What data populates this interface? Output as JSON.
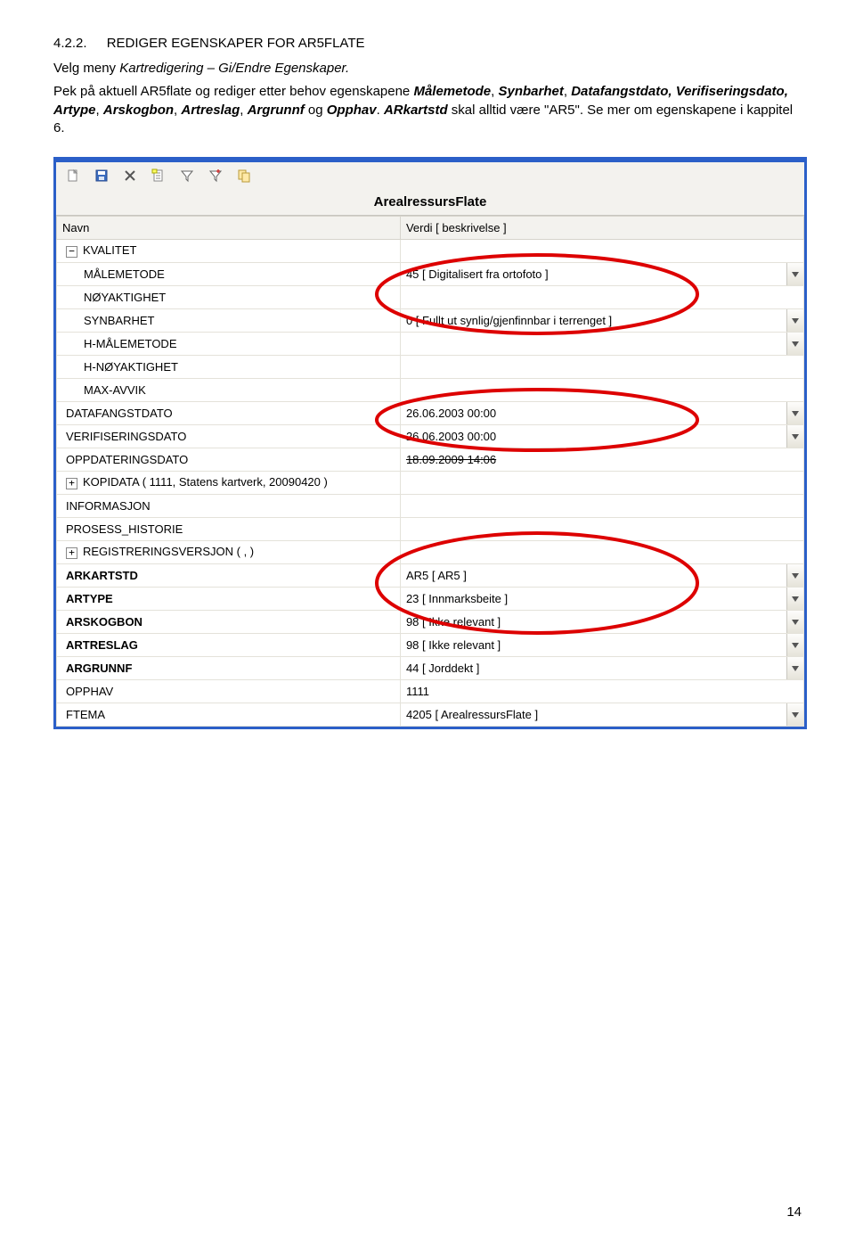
{
  "heading": {
    "num": "4.2.2.",
    "title": "REDIGER EGENSKAPER FOR AR5FLATE"
  },
  "p1_a": "Velg meny ",
  "p1_b": "Kartredigering – Gi/Endre Egenskaper.",
  "p2_a": "Pek på aktuell AR5flate og rediger etter behov egenskapene ",
  "p2_b": "Målemetode",
  "p2_c": ", ",
  "p2_d": "Synbarhet",
  "p2_e": ", ",
  "p2_f": "Datafangstdato, Verifiseringsdato, Artype",
  "p2_g": ", ",
  "p2_h": "Arskogbon",
  "p2_i": ", ",
  "p2_j": "Artreslag",
  "p2_k": ", ",
  "p2_l": "Argrunnf",
  "p2_m": " og ",
  "p2_n": "Opphav",
  "p2_o": ". ",
  "p2_p": "ARkartstd",
  "p2_q": " skal alltid være \"AR5\". Se mer om egenskapene i kappitel 6.",
  "panelTitle": "ArealressursFlate",
  "cols": {
    "name": "Navn",
    "value": "Verdi [ beskrivelse ]"
  },
  "rows": [
    {
      "label": "KVALITET",
      "value": "",
      "level": 0,
      "bold": false,
      "exp": "-"
    },
    {
      "label": "MÅLEMETODE",
      "value": "45 [ Digitalisert fra ortofoto ]",
      "level": 1,
      "dd": true
    },
    {
      "label": "NØYAKTIGHET",
      "value": "",
      "level": 1
    },
    {
      "label": "SYNBARHET",
      "value": "0 [ Fullt ut synlig/gjenfinnbar i terrenget ]",
      "level": 1,
      "dd": true
    },
    {
      "label": "H-MÅLEMETODE",
      "value": "",
      "level": 1,
      "dd": true
    },
    {
      "label": "H-NØYAKTIGHET",
      "value": "",
      "level": 1
    },
    {
      "label": "MAX-AVVIK",
      "value": "",
      "level": 1
    },
    {
      "label": "DATAFANGSTDATO",
      "value": "26.06.2003 00:00",
      "level": 0,
      "dd": true
    },
    {
      "label": "VERIFISERINGSDATO",
      "value": "26.06.2003 00:00",
      "level": 0,
      "dd": true
    },
    {
      "label": "OPPDATERINGSDATO",
      "value": "18.09.2009 14:06",
      "level": 0,
      "strike": true
    },
    {
      "label": "KOPIDATA ( 1111, Statens kartverk, 20090420 )",
      "value": "",
      "level": 0,
      "exp": "+"
    },
    {
      "label": "INFORMASJON",
      "value": "",
      "level": 0
    },
    {
      "label": "PROSESS_HISTORIE",
      "value": "",
      "level": 0
    },
    {
      "label": "REGISTRERINGSVERSJON ( , )",
      "value": "",
      "level": 0,
      "exp": "+"
    },
    {
      "label": "ARKARTSTD",
      "value": "AR5 [ AR5 ]",
      "level": 0,
      "bold": true,
      "dd": true
    },
    {
      "label": "ARTYPE",
      "value": "23 [ Innmarksbeite ]",
      "level": 0,
      "bold": true,
      "dd": true
    },
    {
      "label": "ARSKOGBON",
      "value": "98 [ Ikke relevant ]",
      "level": 0,
      "bold": true,
      "dd": true
    },
    {
      "label": "ARTRESLAG",
      "value": "98 [ Ikke relevant ]",
      "level": 0,
      "bold": true,
      "dd": true
    },
    {
      "label": "ARGRUNNF",
      "value": "44 [ Jorddekt ]",
      "level": 0,
      "bold": true,
      "dd": true
    },
    {
      "label": "OPPHAV",
      "value": "1111",
      "level": 0
    },
    {
      "label": "FTEMA",
      "value": "4205 [ ArealressursFlate ]",
      "level": 0,
      "dd": true
    }
  ],
  "pageNum": "14"
}
